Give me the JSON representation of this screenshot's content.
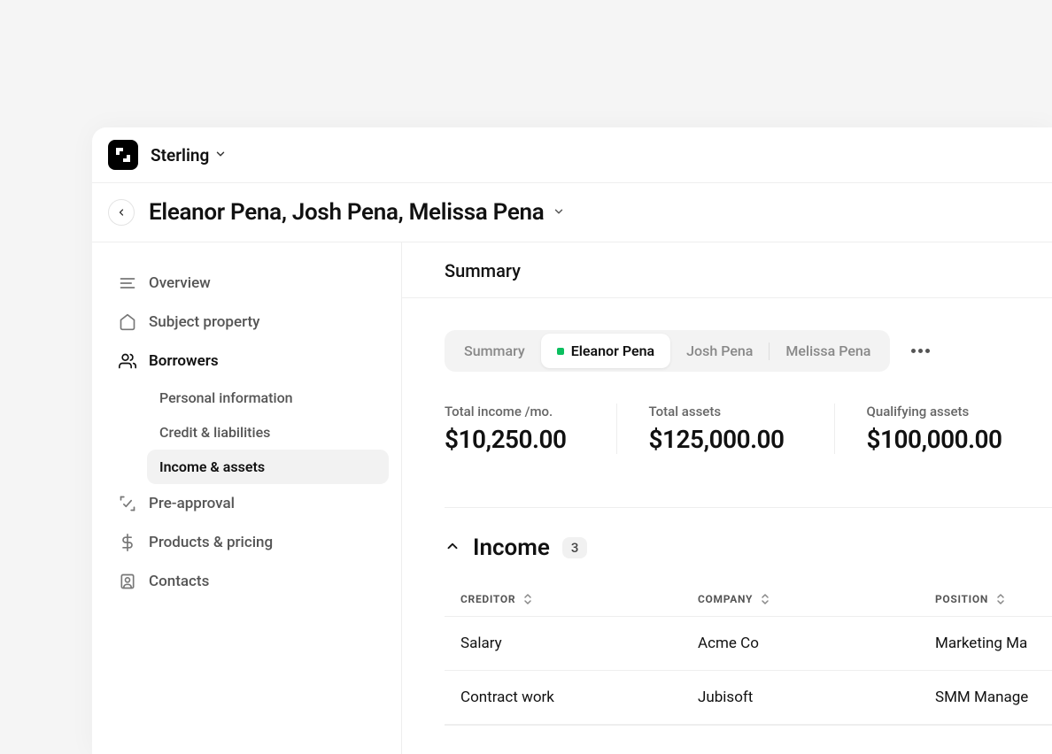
{
  "brand": {
    "name": "Sterling"
  },
  "page": {
    "title": "Eleanor Pena, Josh Pena, Melissa Pena"
  },
  "sidebar": {
    "items": [
      {
        "label": "Overview"
      },
      {
        "label": "Subject property"
      },
      {
        "label": "Borrowers"
      },
      {
        "label": "Pre-approval"
      },
      {
        "label": "Products & pricing"
      },
      {
        "label": "Contacts"
      }
    ],
    "borrowers_sub": [
      {
        "label": "Personal information"
      },
      {
        "label": "Credit & liabilities"
      },
      {
        "label": "Income & assets"
      }
    ]
  },
  "main": {
    "header_title": "Summary",
    "tabs": [
      {
        "label": "Summary"
      },
      {
        "label": "Eleanor Pena"
      },
      {
        "label": "Josh Pena"
      },
      {
        "label": "Melissa Pena"
      }
    ],
    "stats": [
      {
        "label": "Total income /mo.",
        "value": "$10,250.00"
      },
      {
        "label": "Total assets",
        "value": "$125,000.00"
      },
      {
        "label": "Qualifying assets",
        "value": "$100,000.00"
      }
    ],
    "income_section": {
      "title": "Income",
      "count": "3",
      "columns": {
        "creditor": "CREDITOR",
        "company": "COMPANY",
        "position": "POSITION"
      },
      "rows": [
        {
          "creditor": "Salary",
          "company": "Acme Co",
          "position": "Marketing Ma"
        },
        {
          "creditor": "Contract work",
          "company": "Jubisoft",
          "position": "SMM Manage"
        }
      ]
    }
  }
}
